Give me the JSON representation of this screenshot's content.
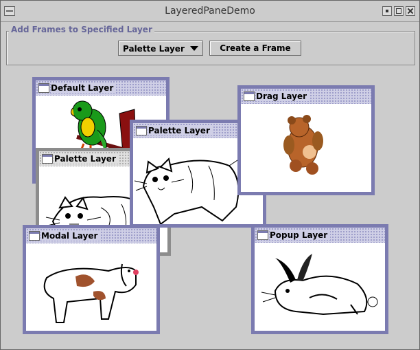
{
  "window": {
    "title": "LayeredPaneDemo"
  },
  "controls": {
    "group_label": "Add Frames to Specified Layer",
    "layer_select_value": "Palette Layer",
    "create_button": "Create a Frame"
  },
  "frames": {
    "default": {
      "title": "Default Layer",
      "image": "parrot-image"
    },
    "palette_back": {
      "title": "Palette Layer",
      "image": "cat-image"
    },
    "palette_front": {
      "title": "Palette Layer",
      "image": "cat-image"
    },
    "drag": {
      "title": "Drag Layer",
      "image": "teddy-bear-image"
    },
    "modal": {
      "title": "Modal Layer",
      "image": "dog-image"
    },
    "popup": {
      "title": "Popup Layer",
      "image": "rabbit-image"
    }
  },
  "colors": {
    "frame_border": "#7b7bb0",
    "inactive_border": "#8c8c8c",
    "label": "#666699"
  }
}
